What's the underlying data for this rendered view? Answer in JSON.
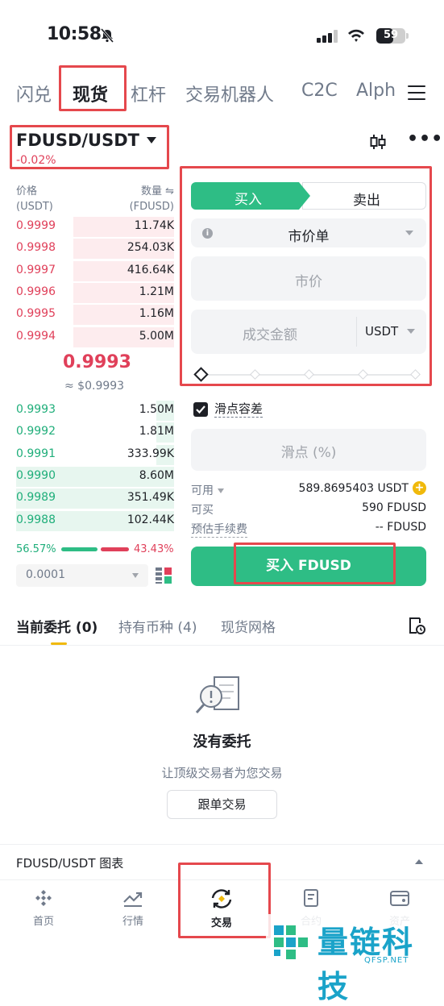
{
  "status_bar": {
    "time": "10:58",
    "battery": "59",
    "battery_fraction": 0.59
  },
  "top_tabs": [
    {
      "label": "闪兑"
    },
    {
      "label": "现货"
    },
    {
      "label": "杠杆"
    },
    {
      "label": "交易机器人"
    },
    {
      "label": "C2C"
    },
    {
      "label": "Alph"
    }
  ],
  "pair": {
    "symbol": "FDUSD/USDT",
    "change": "-0.02%"
  },
  "orderbook": {
    "price_header": "价格",
    "price_unit": "(USDT)",
    "qty_header": "数量",
    "qty_unit": "(FDUSD)",
    "asks": [
      {
        "price": "0.9999",
        "qty": "11.74K",
        "depth": 0.64
      },
      {
        "price": "0.9998",
        "qty": "254.03K",
        "depth": 0.64
      },
      {
        "price": "0.9997",
        "qty": "416.64K",
        "depth": 0.64
      },
      {
        "price": "0.9996",
        "qty": "1.21M",
        "depth": 0.64
      },
      {
        "price": "0.9995",
        "qty": "1.16M",
        "depth": 0.64
      },
      {
        "price": "0.9994",
        "qty": "5.00M",
        "depth": 0.64
      }
    ],
    "last_price": "0.9993",
    "last_price_usd": "≈ $0.9993",
    "bids": [
      {
        "price": "0.9993",
        "qty": "1.50M",
        "depth": 0.11
      },
      {
        "price": "0.9992",
        "qty": "1.81M",
        "depth": 0.11
      },
      {
        "price": "0.9991",
        "qty": "333.99K",
        "depth": 0.11
      },
      {
        "price": "0.9990",
        "qty": "8.60M",
        "depth": 1.0
      },
      {
        "price": "0.9989",
        "qty": "351.49K",
        "depth": 1.0
      },
      {
        "price": "0.9988",
        "qty": "102.44K",
        "depth": 1.0
      }
    ],
    "buy_ratio": "56.57%",
    "sell_ratio": "43.43%",
    "buy_ratio_value": 0.5657,
    "precision": "0.0001"
  },
  "trade_form": {
    "buy_label": "买入",
    "sell_label": "卖出",
    "order_type": "市价单",
    "market_price_placeholder": "市价",
    "amount_placeholder": "成交金额",
    "amount_unit": "USDT",
    "slider_value": 0,
    "slippage_label": "滑点容差",
    "slippage_checked": true,
    "slippage_placeholder": "滑点 (%)",
    "available_label": "可用",
    "available_value": "589.8695403 USDT",
    "can_buy_label": "可买",
    "can_buy_value": "590 FDUSD",
    "fee_label": "预估手续费",
    "fee_value": "-- FDUSD",
    "submit_label": "买入 FDUSD"
  },
  "order_tabs": [
    {
      "label": "当前委托 (0)"
    },
    {
      "label": "持有币种 (4)"
    },
    {
      "label": "现货网格"
    }
  ],
  "empty_state": {
    "title": "没有委托",
    "subtitle": "让顶级交易者为您交易",
    "button": "跟单交易"
  },
  "chart_section": {
    "label": "FDUSD/USDT 图表"
  },
  "bottom_nav": [
    {
      "label": "首页",
      "icon": "binance-logo-icon"
    },
    {
      "label": "行情",
      "icon": "market-chart-icon"
    },
    {
      "label": "交易",
      "icon": "trade-swap-icon"
    },
    {
      "label": "合约",
      "icon": "futures-icon"
    },
    {
      "label": "资产",
      "icon": "wallet-icon"
    }
  ],
  "watermark": {
    "title": "量链科技",
    "domain": "QFSP.NET"
  },
  "colors": {
    "buy": "#2ebd85",
    "sell": "#e0405a",
    "accent": "#f0b90b",
    "highlight": "#e5484d"
  }
}
